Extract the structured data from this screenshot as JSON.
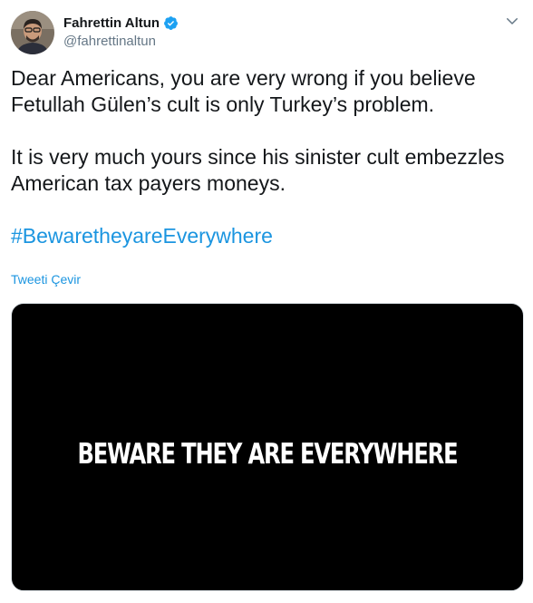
{
  "author": {
    "display_name": "Fahrettin Altun",
    "handle": "@fahrettinaltun",
    "verified": true,
    "avatar_icon": "user-photo-icon"
  },
  "tweet": {
    "paragraph_1": "Dear Americans, you are very wrong if you believe Fetullah Gülen’s cult is only Turkey’s problem.",
    "paragraph_2": "It is very much yours since his sinister cult embezzles American tax payers moneys.",
    "hashtag": "#BewaretheyareEverywhere",
    "translate_label": "Tweeti Çevir"
  },
  "media": {
    "type": "video",
    "overlay_text": "BEWARE THEY ARE EVERYWHERE"
  },
  "icons": {
    "verified": "verified-badge-icon",
    "menu": "chevron-down-icon"
  },
  "colors": {
    "link": "#1b95e0",
    "text": "#14171a",
    "secondary": "#657786",
    "verified": "#1da1f2"
  }
}
